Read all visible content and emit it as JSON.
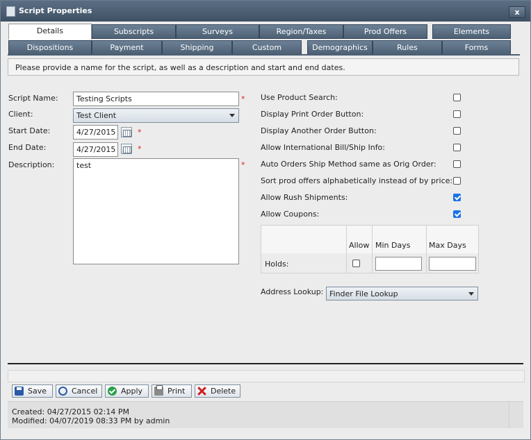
{
  "window": {
    "title": "Script Properties",
    "close_label": "x"
  },
  "tabs_row1": [
    "Details",
    "Subscripts",
    "Surveys",
    "Region/Taxes",
    "Prod Offers",
    "Elements"
  ],
  "tabs_row2": [
    "Dispositions",
    "Payment",
    "Shipping",
    "Custom",
    "Demographics",
    "Rules",
    "Forms"
  ],
  "active_tab": "Details",
  "info_text": "Please provide a name for the script, as well as a description and start and end dates.",
  "form": {
    "script_name_label": "Script Name:",
    "script_name_value": "Testing Scripts",
    "client_label": "Client:",
    "client_value": "Test Client",
    "start_date_label": "Start Date:",
    "start_date_value": "4/27/2015",
    "end_date_label": "End Date:",
    "end_date_value": "4/27/2015",
    "description_label": "Description:",
    "description_value": "test",
    "required_mark": "*"
  },
  "options": [
    {
      "label": "Use Product Search:",
      "checked": false
    },
    {
      "label": "Display Print Order Button:",
      "checked": false
    },
    {
      "label": "Display Another Order Button:",
      "checked": false
    },
    {
      "label": "Allow International Bill/Ship Info:",
      "checked": false
    },
    {
      "label": "Auto Orders Ship Method same as Orig Order:",
      "checked": false
    },
    {
      "label": "Sort prod offers alphabetically instead of by price:",
      "checked": false
    },
    {
      "label": "Allow Rush Shipments:",
      "checked": true
    },
    {
      "label": "Allow Coupons:",
      "checked": true
    }
  ],
  "holds": {
    "allow_header": "Allow",
    "min_days_header": "Min Days",
    "max_days_header": "Max Days",
    "row_label": "Holds:",
    "allow_checked": false,
    "min_days_value": "",
    "max_days_value": ""
  },
  "address_lookup": {
    "label": "Address Lookup:",
    "value": "Finder File Lookup"
  },
  "buttons": {
    "save": "Save",
    "cancel": "Cancel",
    "apply": "Apply",
    "print": "Print",
    "delete": "Delete"
  },
  "footer": {
    "created": "Created: 04/27/2015 02:14 PM",
    "modified": "Modified: 04/07/2019 08:33 PM by admin"
  }
}
